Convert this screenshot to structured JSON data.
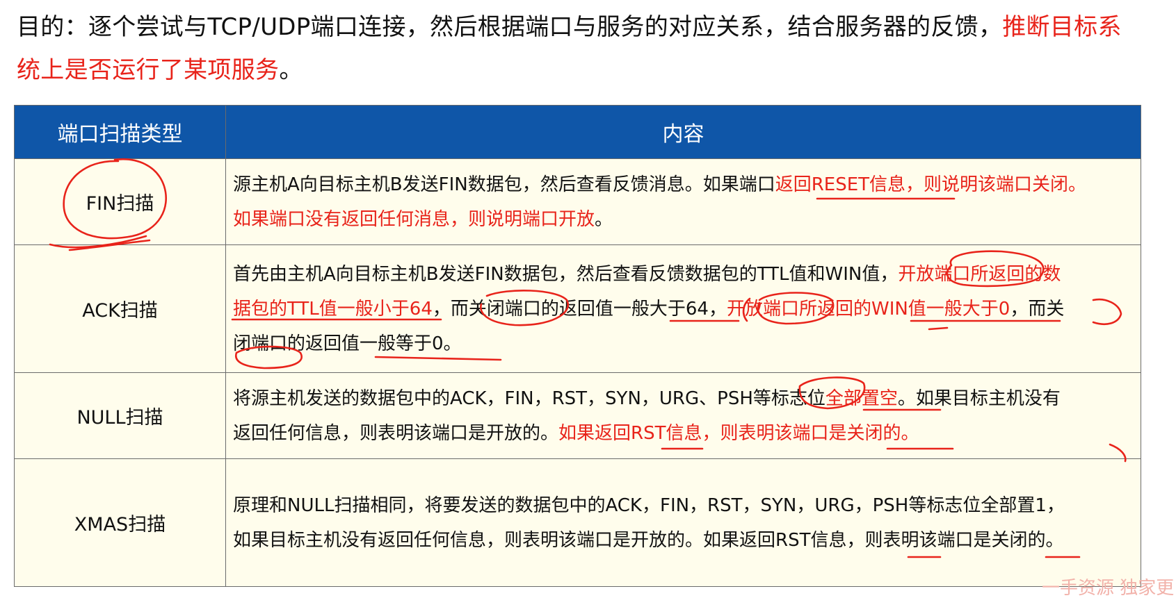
{
  "intro": {
    "text_normal": "目的：逐个尝试与TCP/UDP端口连接，然后根据端口与服务的对应关系，结合服务器的反馈，",
    "text_highlight": "推断目标系统上是否运行了某项服务",
    "text_end": "。"
  },
  "table": {
    "headers": [
      "端口扫描类型",
      "内容"
    ],
    "rows": [
      {
        "type": "FIN扫描",
        "lines": [
          [
            {
              "t": "源主机A向目标主机B发送FIN数据包，然后查看反馈消息。如果端口",
              "red": false
            },
            {
              "t": "返回RESET信息，则说明该端口关闭。",
              "red": true
            }
          ],
          [
            {
              "t": "如果端口没有返回任何消息，则说明端口开放",
              "red": true
            },
            {
              "t": "。",
              "red": false
            }
          ]
        ]
      },
      {
        "type": "ACK扫描",
        "lines": [
          [
            {
              "t": "首先由主机A向目标主机B发送FIN数据包，然后查看反馈数据包的TTL值和WIN值，",
              "red": false
            },
            {
              "t": "开放端口所返回的数",
              "red": true
            }
          ],
          [
            {
              "t": "据包的TTL值一般小于64",
              "red": true
            },
            {
              "t": "，而关闭端口的返回值一般大于64，",
              "red": false
            },
            {
              "t": "开放端口所返回的WIN值一般大于0",
              "red": true
            },
            {
              "t": "，而关",
              "red": false
            }
          ],
          [
            {
              "t": "闭端口的返回值一般等于0。",
              "red": false
            }
          ]
        ]
      },
      {
        "type": "NULL扫描",
        "lines": [
          [
            {
              "t": "将源主机发送的数据包中的ACK，FIN，RST，SYN，URG、PSH等标志位",
              "red": false
            },
            {
              "t": "全部置空",
              "red": true
            },
            {
              "t": "。如果目标主机没有",
              "red": false
            }
          ],
          [
            {
              "t": "返回任何信息，则表明该端口是开放的。",
              "red": false
            },
            {
              "t": "如果返回RST信息，则表明该端口是关闭的。",
              "red": true
            }
          ]
        ]
      },
      {
        "type": "XMAS扫描",
        "lines": [
          [
            {
              "t": "原理和NULL扫描相同，将要发送的数据包中的ACK，FIN，RST，SYN，URG，PSH等标志位全部置1，",
              "red": false
            }
          ],
          [
            {
              "t": "如果目标主机没有返回任何信息，则表明该端口是开放的。如果返回RST信息，则表明该端口是关闭的。",
              "red": false
            }
          ]
        ]
      }
    ]
  },
  "watermark": "一手资源 独家更",
  "colors": {
    "header_bg": "#0f56a8",
    "cell_bg": "#fffdec",
    "highlight": "#e8231a",
    "ink": "#e8231a"
  }
}
